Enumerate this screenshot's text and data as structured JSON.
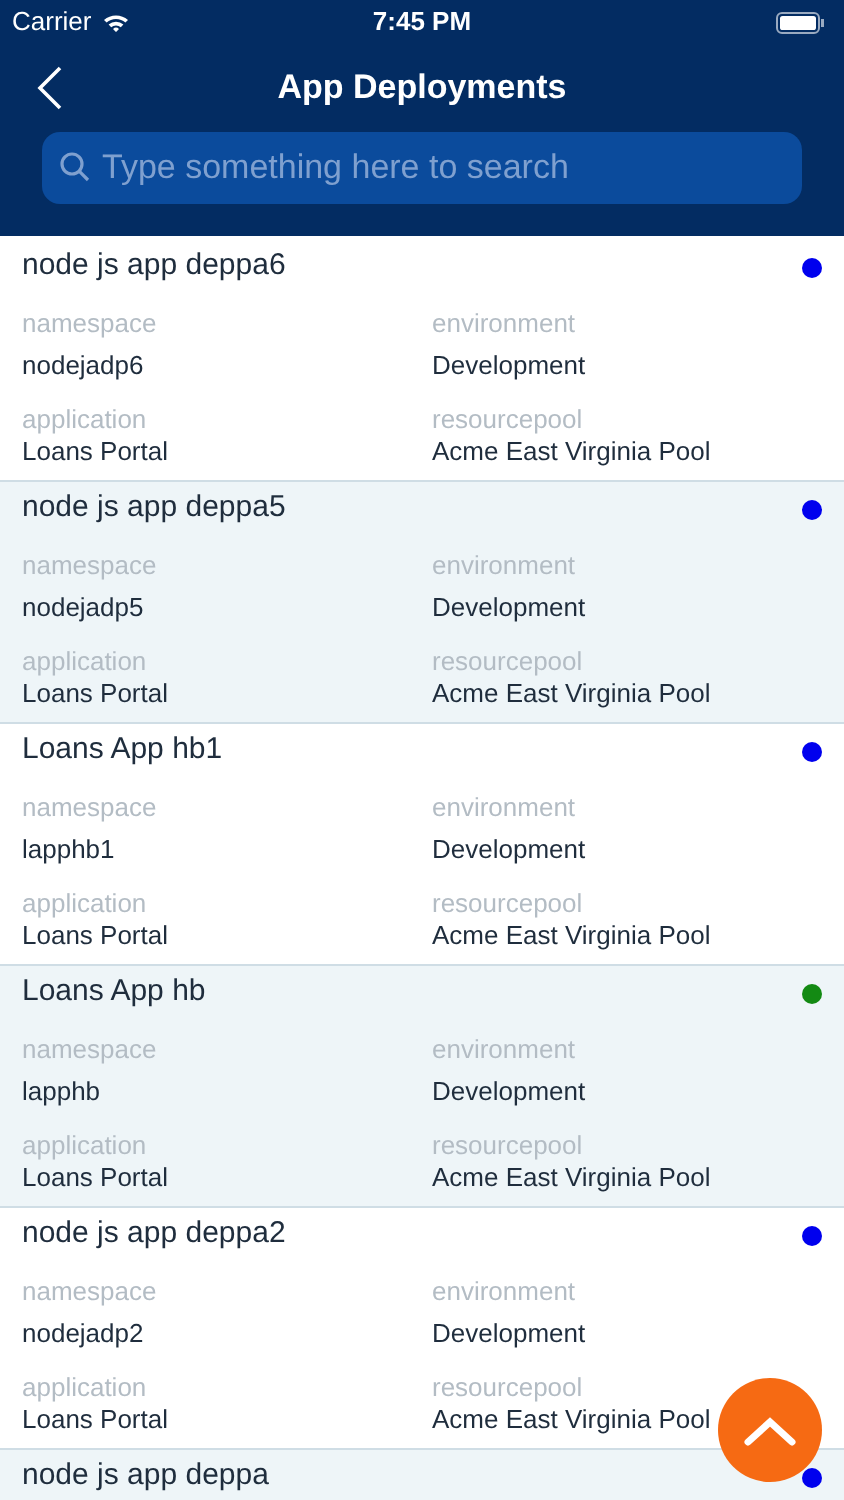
{
  "status_bar": {
    "carrier": "Carrier",
    "time": "7:45 PM"
  },
  "header": {
    "title": "App Deployments"
  },
  "search": {
    "placeholder": "Type something here to search"
  },
  "deployments": [
    {
      "name": "node js app deppa6",
      "color": "#0000ee",
      "fields": [
        {
          "label": "namespace",
          "value": "nodejadp6"
        },
        {
          "label": "environment",
          "value": "Development"
        },
        {
          "label": "application",
          "value": "Loans Portal"
        },
        {
          "label": "resourcepool",
          "value": "Acme East Virginia Pool"
        }
      ]
    },
    {
      "name": "node js app deppa5",
      "color": "#0000ee",
      "fields": [
        {
          "label": "namespace",
          "value": "nodejadp5"
        },
        {
          "label": "environment",
          "value": "Development"
        },
        {
          "label": "application",
          "value": "Loans Portal"
        },
        {
          "label": "resourcepool",
          "value": "Acme East Virginia Pool"
        }
      ]
    },
    {
      "name": "Loans App hb1",
      "color": "#0000ee",
      "fields": [
        {
          "label": "namespace",
          "value": "lapphb1"
        },
        {
          "label": "environment",
          "value": "Development"
        },
        {
          "label": "application",
          "value": "Loans Portal"
        },
        {
          "label": "resourcepool",
          "value": "Acme East Virginia Pool"
        }
      ]
    },
    {
      "name": "Loans App hb",
      "color": "#138a13",
      "fields": [
        {
          "label": "namespace",
          "value": "lapphb"
        },
        {
          "label": "environment",
          "value": "Development"
        },
        {
          "label": "application",
          "value": "Loans Portal"
        },
        {
          "label": "resourcepool",
          "value": "Acme East Virginia Pool"
        }
      ]
    },
    {
      "name": "node js app deppa2",
      "color": "#0000ee",
      "fields": [
        {
          "label": "namespace",
          "value": "nodejadp2"
        },
        {
          "label": "environment",
          "value": "Development"
        },
        {
          "label": "application",
          "value": "Loans Portal"
        },
        {
          "label": "resourcepool",
          "value": "Acme East Virginia Pool"
        }
      ]
    },
    {
      "name": "node js app deppa",
      "color": "#0000ee"
    }
  ]
}
